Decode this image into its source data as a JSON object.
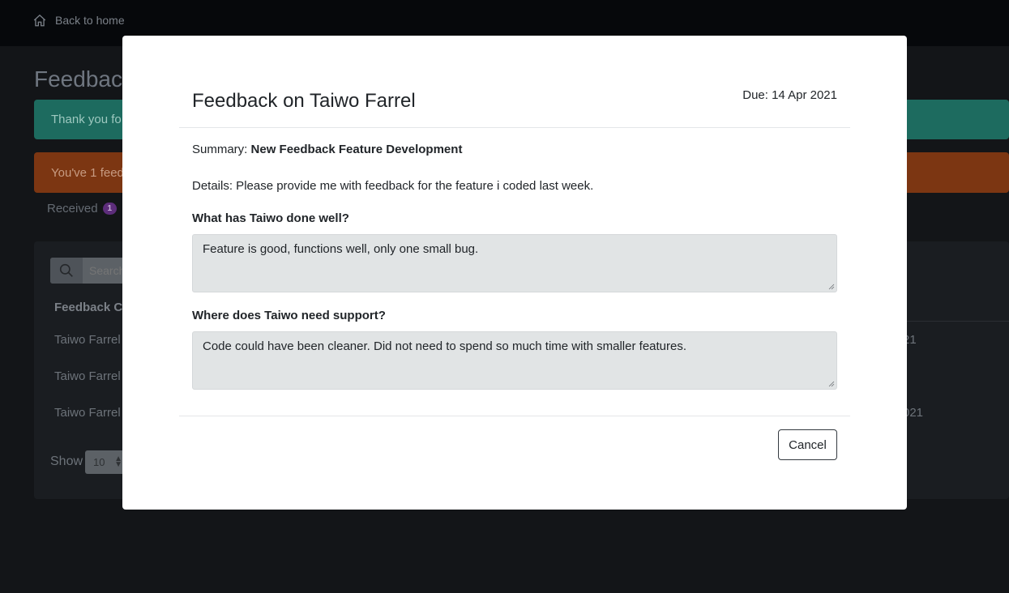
{
  "nav": {
    "back_label": "Back to home"
  },
  "background": {
    "page_title": "Feedback",
    "alert_success": "Thank you fo",
    "alert_warning": "You've 1 feed",
    "tab_received": "Received",
    "tab_received_count": "1",
    "search_placeholder": "Search",
    "table_header": "Feedback C",
    "rows": [
      {
        "name": "Taiwo Farrel",
        "date": "21"
      },
      {
        "name": "Taiwo Farrel",
        "date": ""
      },
      {
        "name": "Taiwo Farrel",
        "date": "021"
      }
    ],
    "show_label": "Show",
    "show_value": "10"
  },
  "modal": {
    "title": "Feedback on Taiwo Farrel",
    "due": "Due: 14 Apr 2021",
    "summary_label": "Summary:",
    "summary_value": "New Feedback Feature Development",
    "details": "Details: Please provide me with feedback for the feature i coded last week.",
    "q1": "What has Taiwo done well?",
    "a1": "Feature is good, functions well, only one small bug.",
    "q2": "Where does Taiwo need support?",
    "a2": "Code could have been cleaner. Did not need to spend so much time with smaller features.",
    "cancel_label": "Cancel"
  },
  "colors": {
    "success": "#1d6b5f",
    "warning": "#7c3612",
    "badge": "#5d2d7b"
  }
}
